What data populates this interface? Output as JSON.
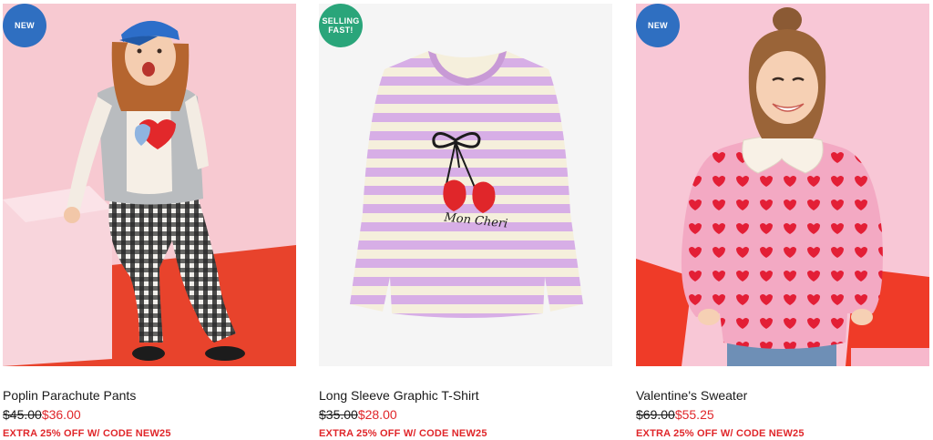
{
  "products": [
    {
      "name": "Poplin Parachute Pants",
      "badge": "NEW",
      "badge_color": "#2f6fc1",
      "price_original": "$45.00",
      "price_sale": "$36.00",
      "promo": "EXTRA 25% OFF W/ CODE NEW25",
      "image_icon": "product-photo-girl-gingham-pants"
    },
    {
      "name": "Long Sleeve Graphic T-Shirt",
      "badge": "SELLING\nFAST!",
      "badge_color": "#2aa57a",
      "price_original": "$35.00",
      "price_sale": "$28.00",
      "promo": "EXTRA 25% OFF W/ CODE NEW25",
      "image_icon": "product-photo-striped-tshirt",
      "graphic_text": "Mon Cheri"
    },
    {
      "name": "Valentine's Sweater",
      "badge": "NEW",
      "badge_color": "#2f6fc1",
      "price_original": "$69.00",
      "price_sale": "$55.25",
      "promo": "EXTRA 25% OFF W/ CODE NEW25",
      "image_icon": "product-photo-girl-heart-sweater"
    }
  ],
  "colors": {
    "sale_red": "#e0262a",
    "text": "#1a1a1a"
  }
}
